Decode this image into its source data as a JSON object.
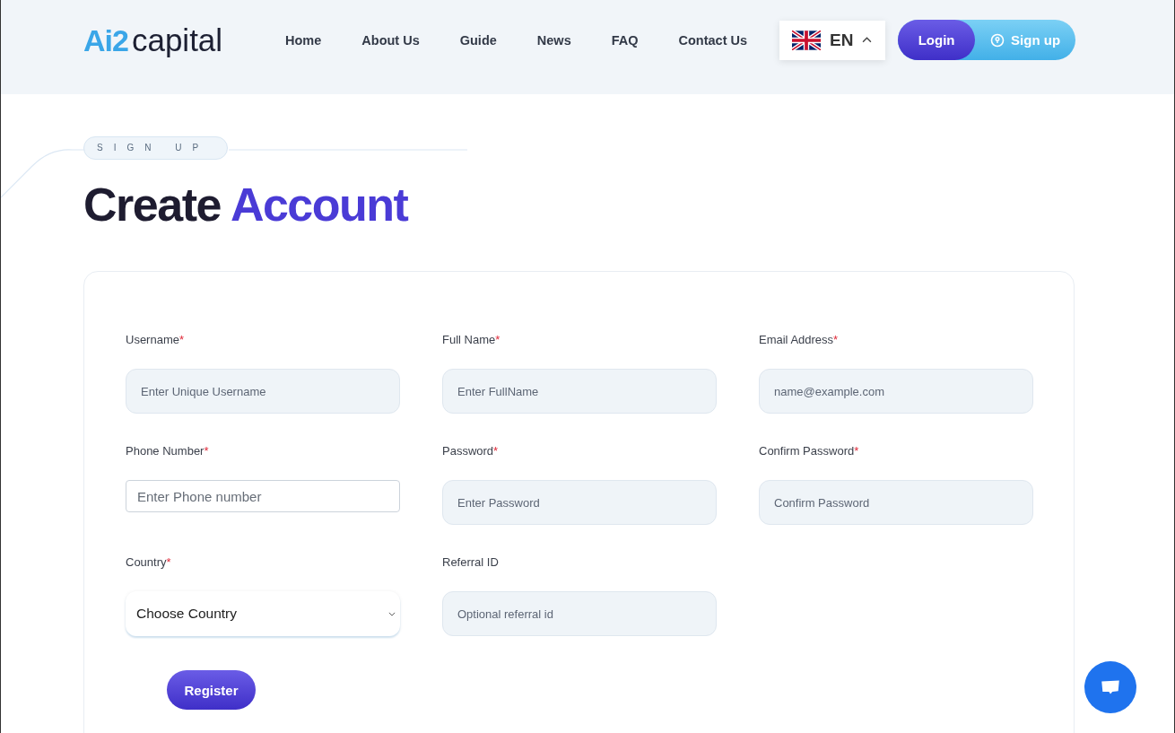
{
  "header": {
    "logo_mark": "Ai2",
    "logo_text": "capital",
    "nav": [
      {
        "label": "Home"
      },
      {
        "label": "About Us"
      },
      {
        "label": "Guide"
      },
      {
        "label": "News"
      },
      {
        "label": "FAQ"
      },
      {
        "label": "Contact Us"
      }
    ],
    "language": {
      "code": "EN",
      "expanded": true
    },
    "auth": [
      {
        "label": "Login",
        "kind": "login"
      },
      {
        "label": "Sign up",
        "kind": "signup"
      }
    ]
  },
  "section_tag": "SIGN UP",
  "heading": {
    "plain": "Create",
    "accent": "Account"
  },
  "form": {
    "fields": [
      {
        "label": "Username",
        "required_mark": "*",
        "kind": "filled",
        "placeholder": "Enter Unique Username"
      },
      {
        "label": "Full Name",
        "required_mark": "*",
        "kind": "filled",
        "placeholder": "Enter FullName"
      },
      {
        "label": "Email Address",
        "required_mark": "*",
        "kind": "filled",
        "placeholder": "name@example.com"
      },
      {
        "label": "Phone Number",
        "required_mark": "*",
        "kind": "plain",
        "placeholder": "Enter Phone number"
      },
      {
        "label": "Password",
        "required_mark": "*",
        "kind": "filled",
        "placeholder": "Enter Password"
      },
      {
        "label": "Confirm Password",
        "required_mark": "*",
        "kind": "filled",
        "placeholder": "Confirm Password"
      },
      {
        "label": "Country",
        "required_mark": "*",
        "kind": "select",
        "value": "Choose Country"
      },
      {
        "label": "Referral ID",
        "kind": "filled",
        "placeholder": "Optional referral id"
      }
    ],
    "submit": "Register"
  }
}
